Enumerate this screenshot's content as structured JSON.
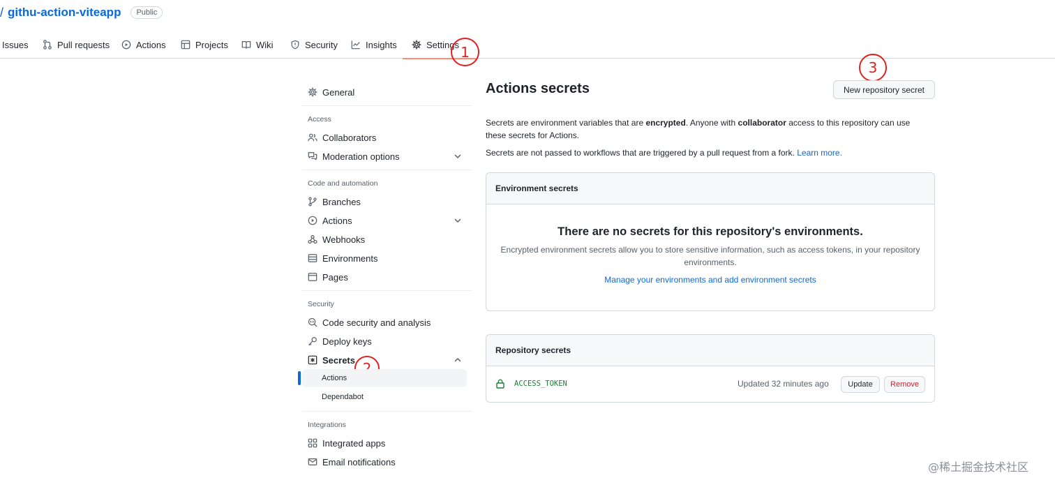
{
  "repo": {
    "slash": "/",
    "name": "githu-action-viteapp",
    "visibility": "Public"
  },
  "tabs": [
    {
      "label": "Issues",
      "icon": "issue-icon"
    },
    {
      "label": "Pull requests",
      "icon": "pull-request-icon"
    },
    {
      "label": "Actions",
      "icon": "play-icon"
    },
    {
      "label": "Projects",
      "icon": "table-icon"
    },
    {
      "label": "Wiki",
      "icon": "book-icon"
    },
    {
      "label": "Security",
      "icon": "shield-icon"
    },
    {
      "label": "Insights",
      "icon": "graph-icon"
    },
    {
      "label": "Settings",
      "icon": "gear-icon",
      "selected": true
    }
  ],
  "annotations": [
    "1",
    "2",
    "3"
  ],
  "sidebar": {
    "general": "General",
    "headings": {
      "access": "Access",
      "code": "Code and automation",
      "security": "Security",
      "integrations": "Integrations"
    },
    "items": {
      "collaborators": "Collaborators",
      "moderation": "Moderation options",
      "branches": "Branches",
      "actions": "Actions",
      "webhooks": "Webhooks",
      "environments": "Environments",
      "pages": "Pages",
      "code_security": "Code security and analysis",
      "deploy_keys": "Deploy keys",
      "secrets": "Secrets",
      "secrets_actions": "Actions",
      "secrets_dependabot": "Dependabot",
      "integrated_apps": "Integrated apps",
      "email_notifications": "Email notifications"
    }
  },
  "main": {
    "title": "Actions secrets",
    "new_secret_button": "New repository secret",
    "desc1": {
      "a": "Secrets are environment variables that are ",
      "b": "encrypted",
      "c": ". Anyone with ",
      "d": "collaborator",
      "e": " access to this repository can use these secrets for Actions."
    },
    "desc2": {
      "text": "Secrets are not passed to workflows that are triggered by a pull request from a fork. ",
      "link": "Learn more."
    },
    "env_secrets": {
      "header": "Environment secrets",
      "blank_title": "There are no secrets for this repository's environments.",
      "blank_desc": "Encrypted environment secrets allow you to store sensitive information, such as access tokens, in your repository environments.",
      "manage_link": "Manage your environments and add environment secrets"
    },
    "repo_secrets": {
      "header": "Repository secrets",
      "rows": [
        {
          "name": "ACCESS_TOKEN",
          "updated": "Updated 32 minutes ago",
          "update_label": "Update",
          "remove_label": "Remove"
        }
      ]
    }
  },
  "watermark": "@稀土掘金技术社区"
}
